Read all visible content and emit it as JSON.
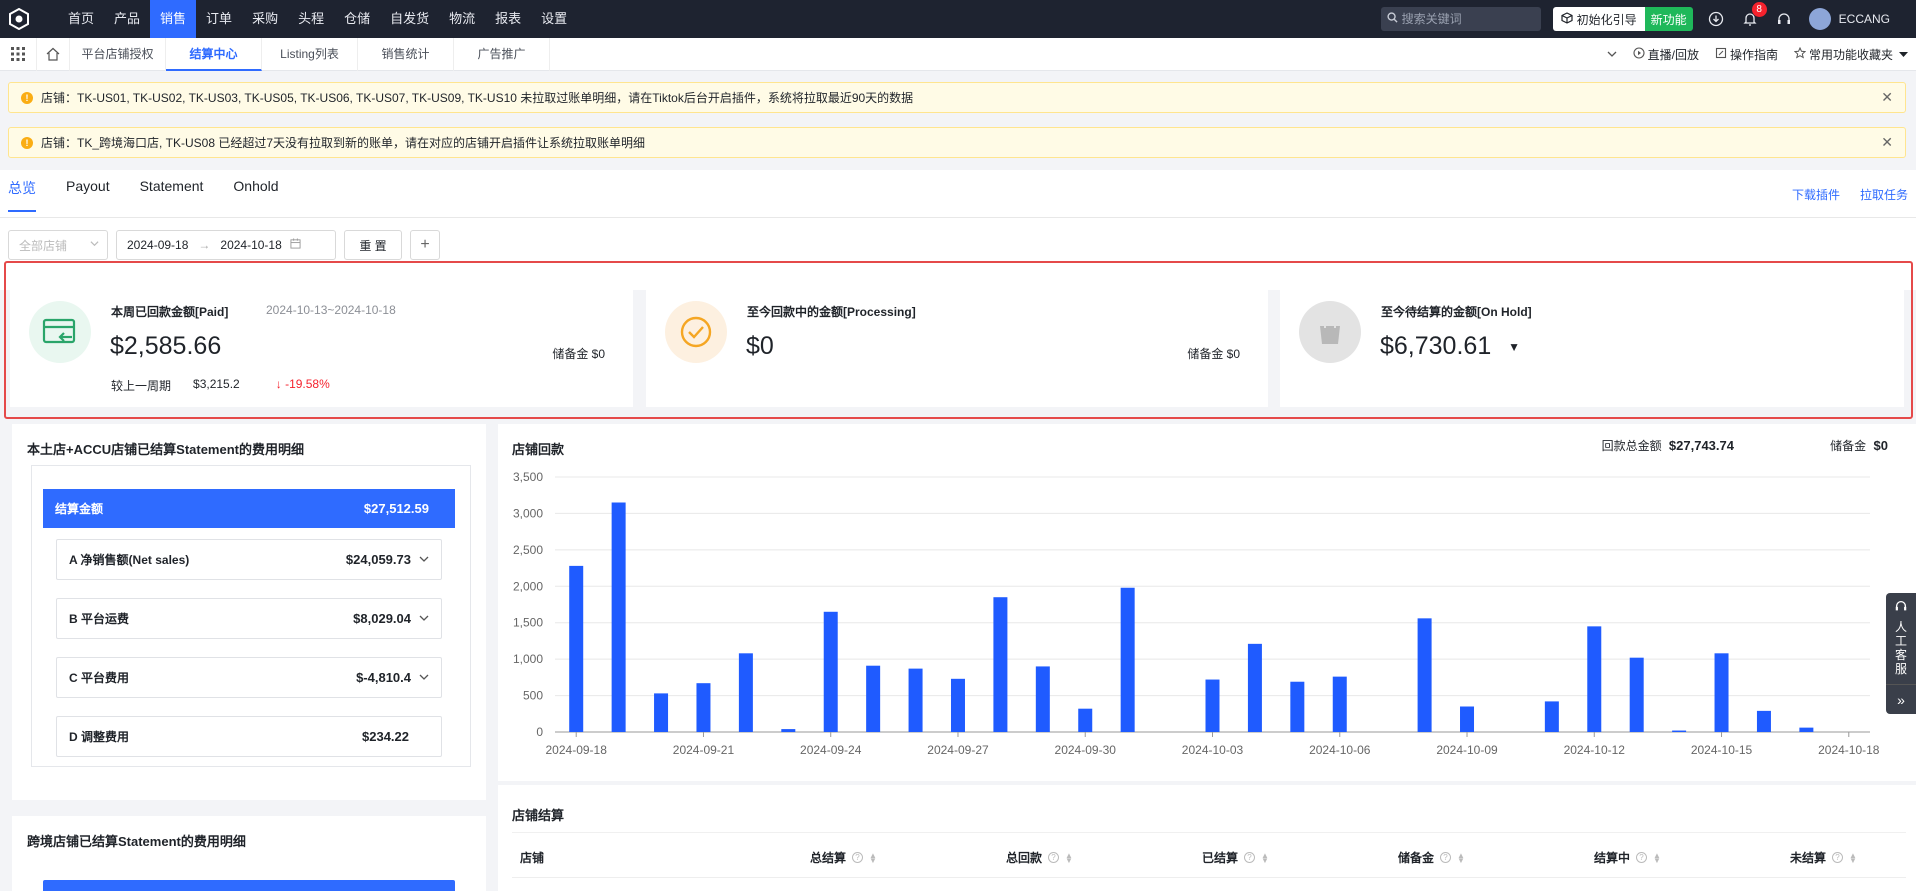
{
  "topnav": {
    "items": [
      {
        "label": "首页"
      },
      {
        "label": "产品"
      },
      {
        "label": "销售",
        "active": true
      },
      {
        "label": "订单"
      },
      {
        "label": "采购"
      },
      {
        "label": "头程"
      },
      {
        "label": "仓储"
      },
      {
        "label": "自发货"
      },
      {
        "label": "物流"
      },
      {
        "label": "报表"
      },
      {
        "label": "设置"
      }
    ],
    "search_placeholder": "搜索关键词",
    "guide_label": "初始化引导",
    "new_feature_label": "新功能",
    "notification_count": "8",
    "user_name": "ECCANG"
  },
  "subnav": {
    "tabs": [
      {
        "label": "平台店铺授权"
      },
      {
        "label": "结算中心",
        "active": true
      },
      {
        "label": "Listing列表"
      },
      {
        "label": "销售统计"
      },
      {
        "label": "广告推广"
      }
    ],
    "live_label": "直播/回放",
    "guide_label": "操作指南",
    "favorites_label": "常用功能收藏夹"
  },
  "alerts": [
    "店铺：TK-US01, TK-US02, TK-US03, TK-US05, TK-US06, TK-US07, TK-US09, TK-US10 未拉取过账单明细，请在Tiktok后台开启插件，系统将拉取最近90天的数据",
    "店铺：TK_跨境海口店, TK-US08 已经超过7天没有拉取到新的账单，请在对应的店铺开启插件让系统拉取账单明细"
  ],
  "tabs": {
    "items": [
      {
        "label": "总览",
        "active": true
      },
      {
        "label": "Payout"
      },
      {
        "label": "Statement"
      },
      {
        "label": "Onhold"
      }
    ],
    "download_plugin": "下载插件",
    "pull_task": "拉取任务"
  },
  "filters": {
    "store_placeholder": "全部店铺",
    "date_start": "2024-09-18",
    "date_end": "2024-10-18",
    "reset_label": "重 置",
    "add_label": "+"
  },
  "kpi": {
    "paid": {
      "title": "本周已回款金额[Paid]",
      "range": "2024-10-13~2024-10-18",
      "amount": "$2,585.66",
      "reserve": "储备金 $0",
      "compare_label": "较上一周期",
      "compare_prev": "$3,215.2",
      "compare_change": "-19.58%"
    },
    "processing": {
      "title": "至今回款中的金额[Processing]",
      "amount": "$0",
      "reserve": "储备金 $0"
    },
    "onhold": {
      "title": "至今待结算的金额[On Hold]",
      "amount": "$6,730.61"
    }
  },
  "local_statement": {
    "title": "本土店+ACCU店铺已结算Statement的费用明细",
    "head_label": "结算金额",
    "head_amount": "$27,512.59",
    "rows": [
      {
        "label": "A 净销售额(Net sales)",
        "amount": "$24,059.73"
      },
      {
        "label": "B 平台运费",
        "amount": "$8,029.04"
      },
      {
        "label": "C 平台费用",
        "amount": "$-4,810.4"
      },
      {
        "label": "D 调整费用",
        "amount": "$234.22"
      }
    ]
  },
  "cross_statement": {
    "title": "跨境店铺已结算Statement的费用明细"
  },
  "store_payout": {
    "title": "店铺回款",
    "total_label": "回款总金额",
    "total_value": "$27,743.74",
    "reserve_label": "储备金",
    "reserve_value": "$0"
  },
  "chart_data": {
    "type": "bar",
    "x_tick_labels": [
      "2024-09-18",
      "2024-09-21",
      "2024-09-24",
      "2024-09-27",
      "2024-09-30",
      "2024-10-03",
      "2024-10-06",
      "2024-10-09",
      "2024-10-12",
      "2024-10-15",
      "2024-10-18"
    ],
    "y_ticks": [
      0,
      500,
      1000,
      1500,
      2000,
      2500,
      3000,
      3500
    ],
    "ylim": [
      0,
      3500
    ],
    "grid": true,
    "color": "#1f5bff",
    "categories": [
      "2024-09-18",
      "2024-09-19",
      "2024-09-20",
      "2024-09-21",
      "2024-09-22",
      "2024-09-23",
      "2024-09-24",
      "2024-09-25",
      "2024-09-26",
      "2024-09-27",
      "2024-09-28",
      "2024-09-29",
      "2024-09-30",
      "2024-10-01",
      "2024-10-02",
      "2024-10-03",
      "2024-10-04",
      "2024-10-05",
      "2024-10-06",
      "2024-10-07",
      "2024-10-08",
      "2024-10-09",
      "2024-10-10",
      "2024-10-11",
      "2024-10-12",
      "2024-10-13",
      "2024-10-14",
      "2024-10-15",
      "2024-10-16",
      "2024-10-17",
      "2024-10-18"
    ],
    "values": [
      2280,
      3150,
      530,
      670,
      1080,
      40,
      1650,
      910,
      870,
      730,
      1850,
      900,
      320,
      1980,
      0,
      720,
      1210,
      690,
      760,
      0,
      1560,
      350,
      0,
      420,
      1450,
      1020,
      20,
      1080,
      290,
      60,
      0
    ]
  },
  "store_settlement": {
    "title": "店铺结算",
    "columns": [
      {
        "label": "店铺"
      },
      {
        "label": "总结算"
      },
      {
        "label": "总回款"
      },
      {
        "label": "已结算"
      },
      {
        "label": "储备金"
      },
      {
        "label": "结算中"
      },
      {
        "label": "未结算"
      }
    ]
  },
  "side_float": {
    "label": "人工客服",
    "more": "»"
  }
}
